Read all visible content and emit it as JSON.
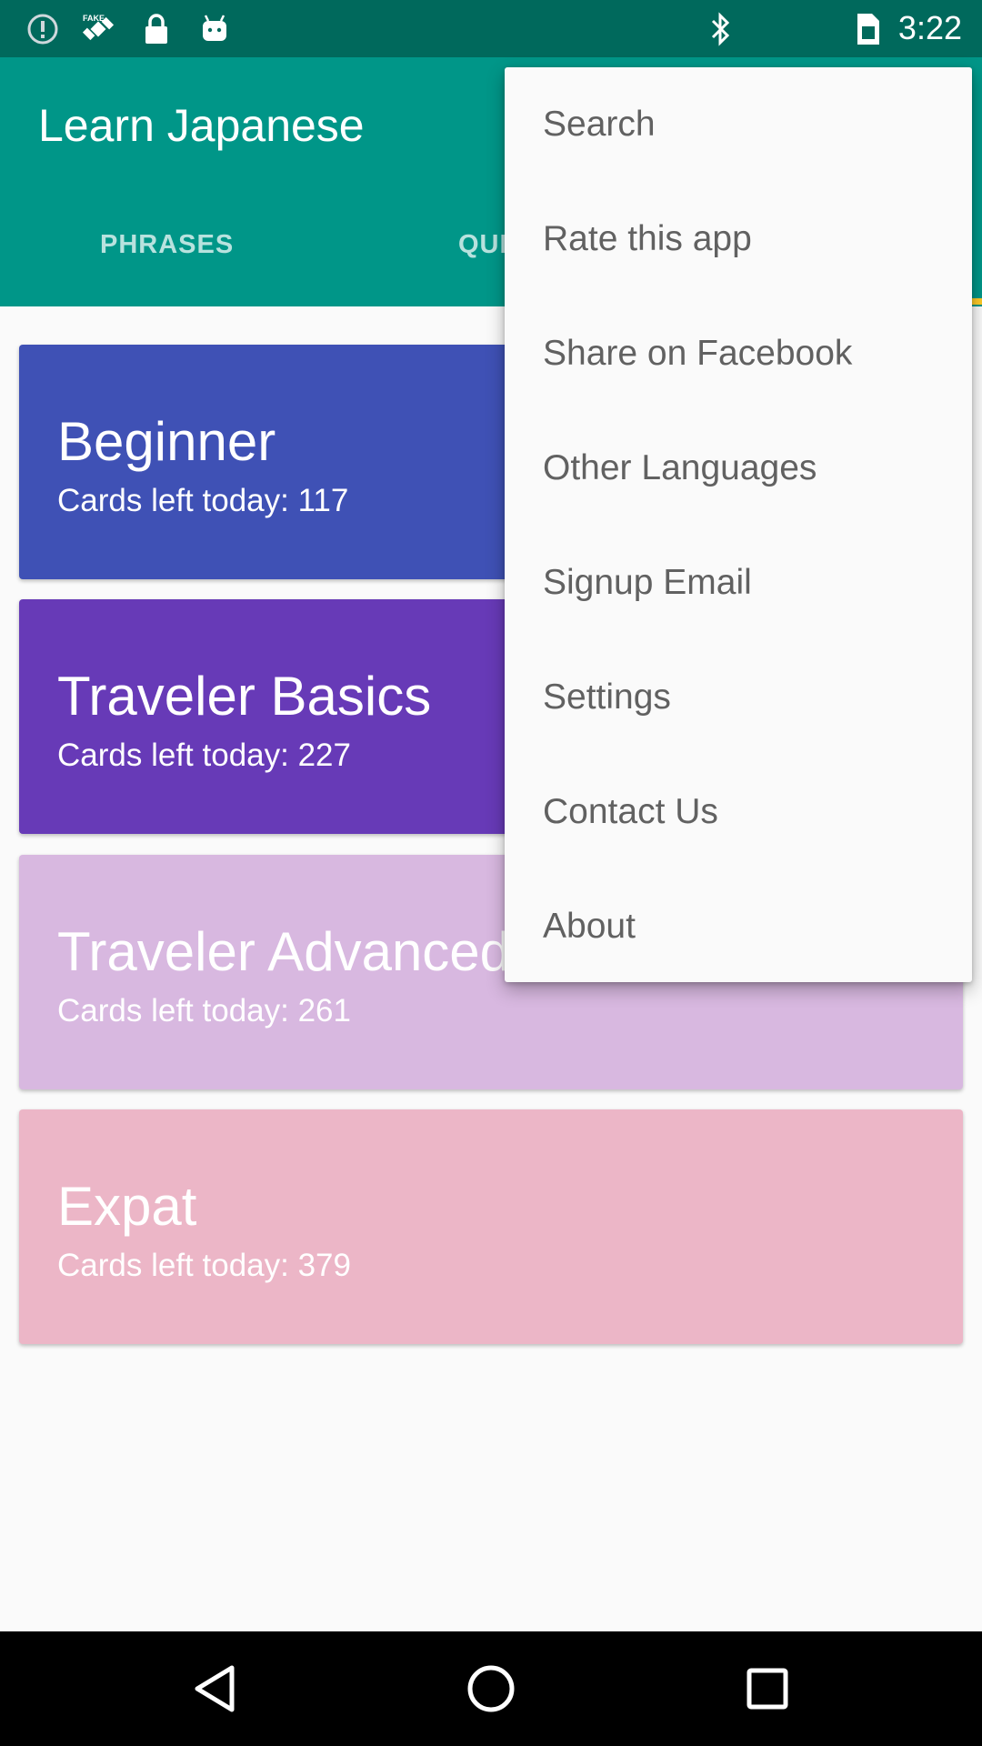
{
  "status_bar": {
    "time": "3:22",
    "left_icons": [
      "info-circle-icon",
      "fake-gps-satellite-icon",
      "lock-icon",
      "android-icon"
    ],
    "right_icons": [
      "bluetooth-icon",
      "sim-card-icon"
    ]
  },
  "app_bar": {
    "title": "Learn Japanese",
    "tabs": [
      {
        "label": "PHRASES"
      },
      {
        "label": "QUI"
      }
    ],
    "color": "#009688",
    "status_color": "#00695c",
    "indicator_color": "#ffca28"
  },
  "cards": [
    {
      "title": "Beginner",
      "subtitle": "Cards left today: 117",
      "color": "#3f51b5"
    },
    {
      "title": "Traveler Basics",
      "subtitle": "Cards left today: 227",
      "color": "#673ab7"
    },
    {
      "title": "Traveler Advanced",
      "subtitle": "Cards left today: 261",
      "color": "#d8b8e0"
    },
    {
      "title": "Expat",
      "subtitle": "Cards left today: 379",
      "color": "#ecb6c7"
    }
  ],
  "menu": {
    "items": [
      {
        "label": "Search"
      },
      {
        "label": "Rate this app"
      },
      {
        "label": "Share on Facebook"
      },
      {
        "label": "Other Languages"
      },
      {
        "label": "Signup Email"
      },
      {
        "label": "Settings"
      },
      {
        "label": "Contact Us"
      },
      {
        "label": "About"
      }
    ]
  },
  "nav_bar": {
    "buttons": [
      "back-triangle-icon",
      "home-circle-icon",
      "recents-square-icon"
    ]
  }
}
